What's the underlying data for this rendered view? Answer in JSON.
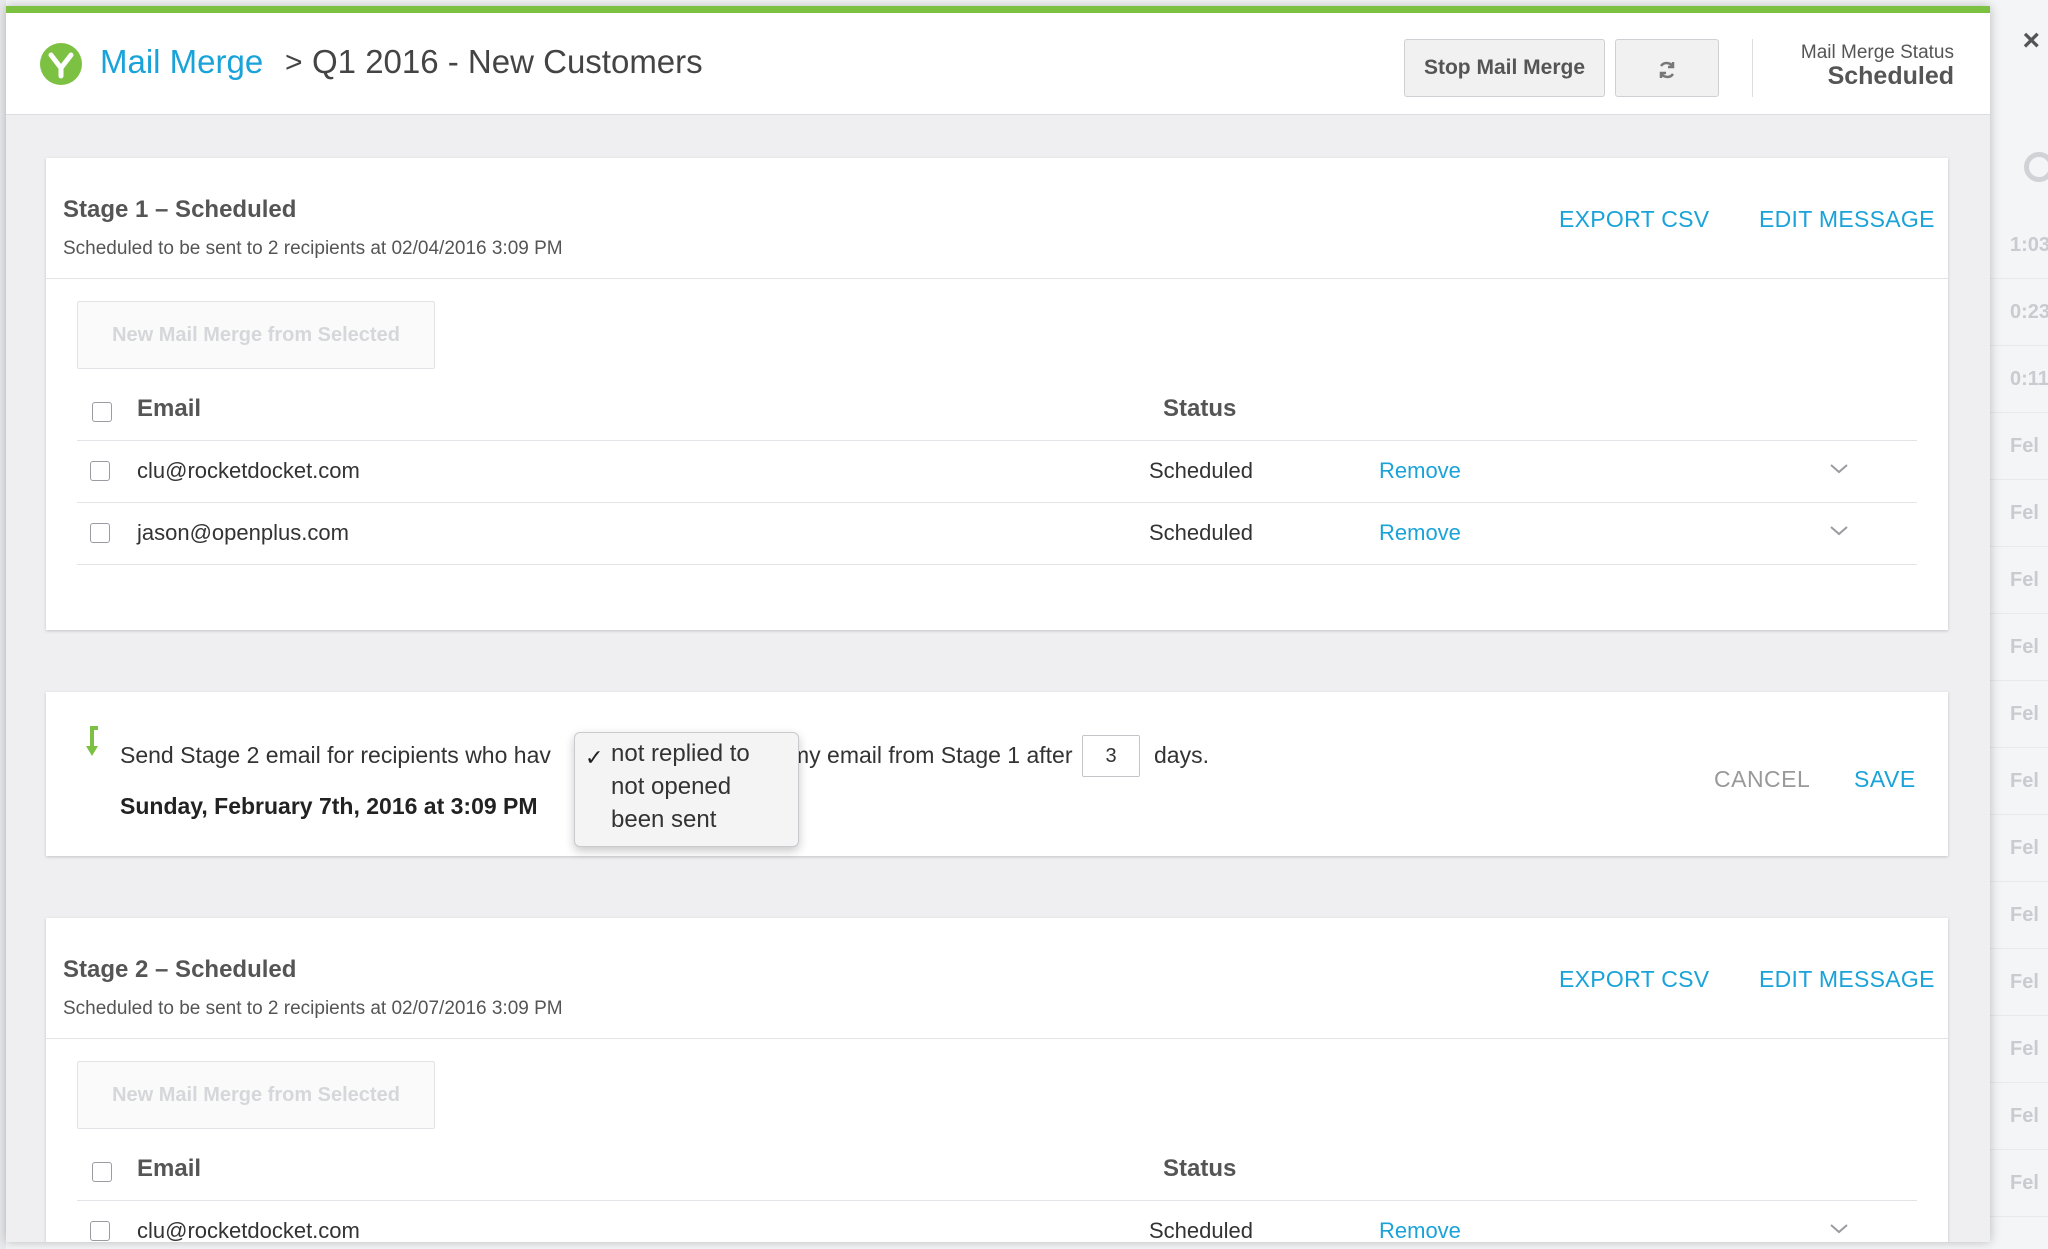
{
  "header": {
    "app_link": "Mail Merge",
    "breadcrumb_separator": ">",
    "campaign_title": "Q1 2016 - New Customers",
    "stop_button": "Stop Mail Merge",
    "status_label": "Mail Merge Status",
    "status_value": "Scheduled",
    "accent_color": "#7cc142",
    "link_color": "#1aa3d9"
  },
  "stage1": {
    "title": "Stage 1 – Scheduled",
    "subtitle": "Scheduled to be sent to 2 recipients at 02/04/2016 3:09 PM",
    "export_label": "EXPORT CSV",
    "edit_label": "EDIT MESSAGE",
    "new_merge_label": "New Mail Merge from Selected",
    "col_email": "Email",
    "col_status": "Status",
    "rows": [
      {
        "email": "clu@rocketdocket.com",
        "status": "Scheduled",
        "action": "Remove"
      },
      {
        "email": "jason@openplus.com",
        "status": "Scheduled",
        "action": "Remove"
      }
    ]
  },
  "rule": {
    "text_before": "Send Stage 2 email for recipients who hav",
    "text_middle": "my email from Stage 1 after",
    "days_value": "3",
    "text_after": "days.",
    "scheduled_date": "Sunday, February 7th, 2016 at 3:09 PM",
    "cancel_label": "CANCEL",
    "save_label": "SAVE",
    "dropdown": {
      "selected": "not replied to",
      "check_glyph": "✓",
      "options": [
        "not replied to",
        "not opened",
        "been sent"
      ]
    }
  },
  "stage2": {
    "title": "Stage 2 – Scheduled",
    "subtitle": "Scheduled to be sent to 2 recipients at 02/07/2016 3:09 PM",
    "export_label": "EXPORT CSV",
    "edit_label": "EDIT MESSAGE",
    "new_merge_label": "New Mail Merge from Selected",
    "col_email": "Email",
    "col_status": "Status",
    "rows": [
      {
        "email": "clu@rocketdocket.com",
        "status": "Scheduled",
        "action": "Remove"
      }
    ]
  },
  "background": {
    "close_glyph": "×",
    "list_items": [
      "1:03",
      "0:23",
      "0:11",
      "Fel",
      "Fel",
      "Fel",
      "Fel",
      "Fel",
      "Fel",
      "Fel",
      "Fel",
      "Fel",
      "Fel",
      "Fel",
      "Fel"
    ]
  },
  "icons": {
    "logo": "yesware-logo-icon",
    "refresh": "refresh-icon",
    "chevron": "chevron-down-icon",
    "arrow": "branch-arrow-icon"
  }
}
